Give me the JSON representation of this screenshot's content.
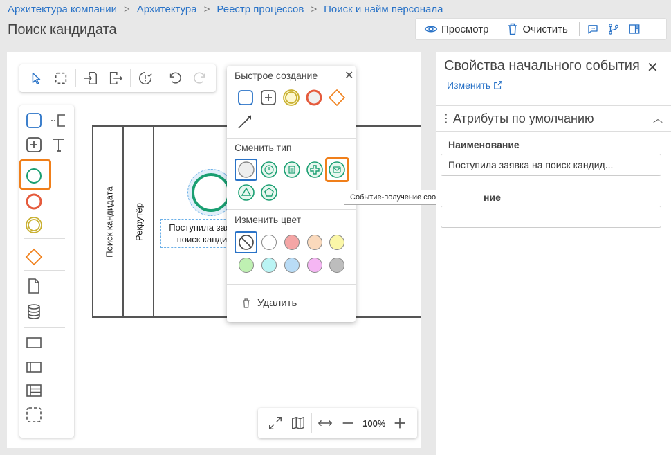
{
  "breadcrumb": [
    "Архитектура компании",
    "Архитектура",
    "Реестр процессов",
    "Поиск и найм персонала"
  ],
  "page_title": "Поиск кандидата",
  "topbar": {
    "view_label": "Просмотр",
    "clear_label": "Очистить"
  },
  "pool": {
    "name": "Поиск кандидата",
    "lane": "Рекрутёр"
  },
  "event_label_line1": "Поступила заяв",
  "event_label_line2": "поиск канди",
  "zoom": "100%",
  "popup": {
    "quick_create": "Быстрое создание",
    "change_type": "Сменить тип",
    "change_color": "Изменить цвет",
    "delete": "Удалить"
  },
  "tooltip": "Событие-получение сообщения",
  "colors": [
    "#ffffff",
    "#f4a5a5",
    "#fad9bc",
    "#fbf7a8",
    "#bff0b2",
    "#baf4f4",
    "#b9dcf6",
    "#f5b6f3",
    "#bdbdbd"
  ],
  "right_panel": {
    "title": "Свойства начального события",
    "change_link": "Изменить",
    "section": "Атрибуты по умолчанию",
    "name_label": "Наименование",
    "name_value": "Поступила заявка на поиск кандид...",
    "desc_label_partial": "ние",
    "desc_value": ""
  }
}
